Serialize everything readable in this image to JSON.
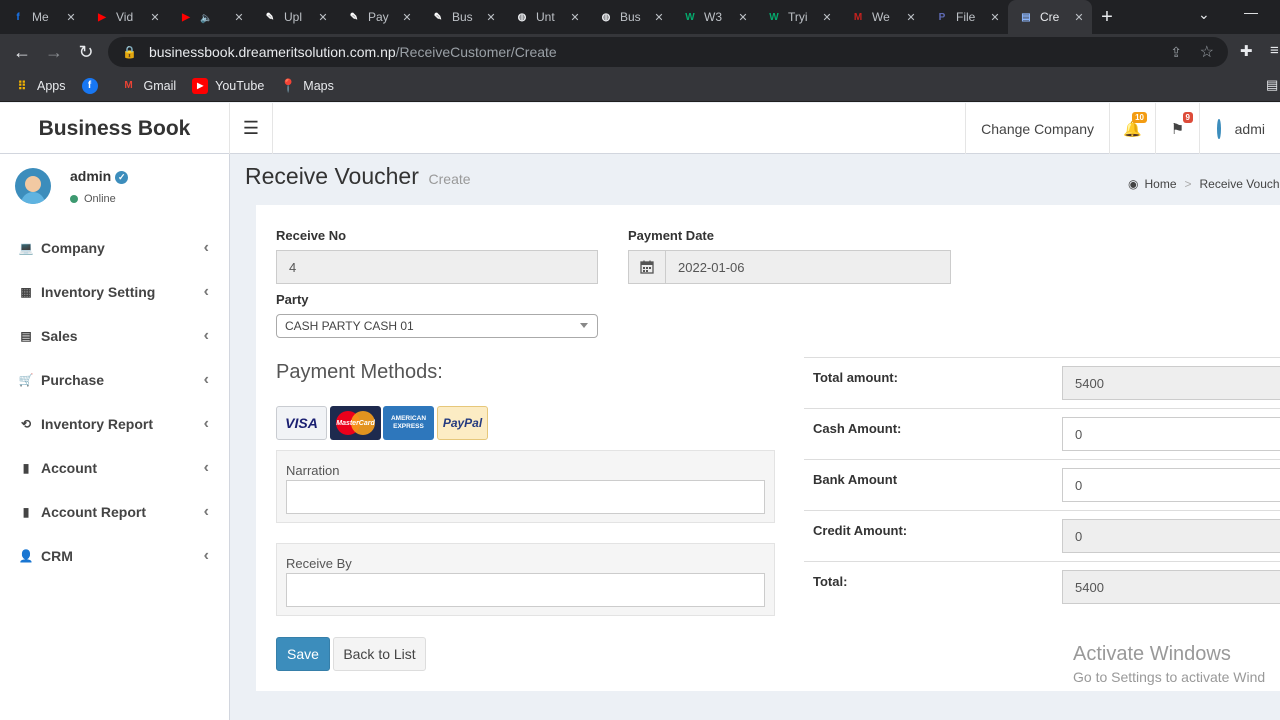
{
  "browser": {
    "tabs": [
      {
        "label": "Me",
        "icon": "facebook-icon",
        "color": "#1877f2",
        "glyph": "f"
      },
      {
        "label": "Vid",
        "icon": "youtube-icon",
        "color": "#ff0000",
        "glyph": "▶"
      },
      {
        "label": "",
        "icon": "youtube-icon",
        "color": "#ff0000",
        "glyph": "▶"
      },
      {
        "label": "Upl",
        "icon": "document-icon",
        "color": "#ffffff",
        "glyph": "✎"
      },
      {
        "label": "Pay",
        "icon": "document-icon",
        "color": "#ffffff",
        "glyph": "✎"
      },
      {
        "label": "Bus",
        "icon": "document-icon",
        "color": "#ffffff",
        "glyph": "✎"
      },
      {
        "label": "Unt",
        "icon": "globe-icon",
        "color": "#e8eaed",
        "glyph": "◍"
      },
      {
        "label": "Bus",
        "icon": "globe-icon",
        "color": "#e8eaed",
        "glyph": "◍"
      },
      {
        "label": "W3",
        "icon": "w3schools-icon",
        "color": "#04aa6d",
        "glyph": "W"
      },
      {
        "label": "Tryi",
        "icon": "w3schools-icon",
        "color": "#04aa6d",
        "glyph": "W"
      },
      {
        "label": "We",
        "icon": "gmail-icon",
        "color": "#c5221f",
        "glyph": "M"
      },
      {
        "label": "File",
        "icon": "p-icon",
        "color": "#5f6bb5",
        "glyph": "P"
      },
      {
        "label": "Cre",
        "icon": "page-icon",
        "color": "#8ab4f8",
        "glyph": "▤"
      }
    ],
    "url_host": "businessbook.dreameritsolution.com.np",
    "url_path": "/ReceiveCustomer/Create",
    "bookmarks": [
      {
        "label": "Apps",
        "icon": "apps-grid-icon"
      },
      {
        "label": "",
        "icon": "facebook-icon"
      },
      {
        "label": "Gmail",
        "icon": "gmail-icon"
      },
      {
        "label": "YouTube",
        "icon": "youtube-icon"
      },
      {
        "label": "Maps",
        "icon": "maps-icon"
      }
    ]
  },
  "header": {
    "logo": "Business Book",
    "change_company": "Change Company",
    "notif_count": "10",
    "flag_count": "9",
    "user": "admi"
  },
  "sidebar": {
    "user_name": "admin",
    "status": "Online",
    "items": [
      {
        "label": "Company",
        "icon": "laptop-icon",
        "glyph": "💻"
      },
      {
        "label": "Inventory Setting",
        "icon": "grid-icon",
        "glyph": "▦"
      },
      {
        "label": "Sales",
        "icon": "invoice-icon",
        "glyph": "▤"
      },
      {
        "label": "Purchase",
        "icon": "cart-icon",
        "glyph": "🛒"
      },
      {
        "label": "Inventory Report",
        "icon": "history-icon",
        "glyph": "⟲"
      },
      {
        "label": "Account",
        "icon": "book-icon",
        "glyph": "▮"
      },
      {
        "label": "Account Report",
        "icon": "report-icon",
        "glyph": "▮"
      },
      {
        "label": "CRM",
        "icon": "user-plus-icon",
        "glyph": "👤"
      }
    ]
  },
  "page": {
    "title": "Receive Voucher",
    "subtitle": "Create",
    "breadcrumb_home": "Home",
    "breadcrumb_current": "Receive Voucher"
  },
  "form": {
    "receive_no_label": "Receive No",
    "receive_no_value": "4",
    "payment_date_label": "Payment Date",
    "payment_date_value": "2022-01-06",
    "party_label": "Party",
    "party_value": "CASH PARTY CASH 01",
    "payment_methods_label": "Payment Methods:",
    "cards": [
      "VISA",
      "MasterCard",
      "AMERICAN EXPRESS",
      "PayPal"
    ],
    "narration_label": "Narration",
    "receive_by_label": "Receive By",
    "save_label": "Save",
    "back_label": "Back to List"
  },
  "summary": [
    {
      "label": "Total amount:",
      "value": "5400",
      "readonly": true
    },
    {
      "label": "Cash Amount:",
      "value": "0",
      "readonly": false
    },
    {
      "label": "Bank Amount",
      "value": "0",
      "readonly": false
    },
    {
      "label": "Credit Amount:",
      "value": "0",
      "readonly": true
    },
    {
      "label": "Total:",
      "value": "5400",
      "readonly": true
    }
  ],
  "watermark": {
    "line1": "Activate Windows",
    "line2": "Go to Settings to activate Wind"
  }
}
